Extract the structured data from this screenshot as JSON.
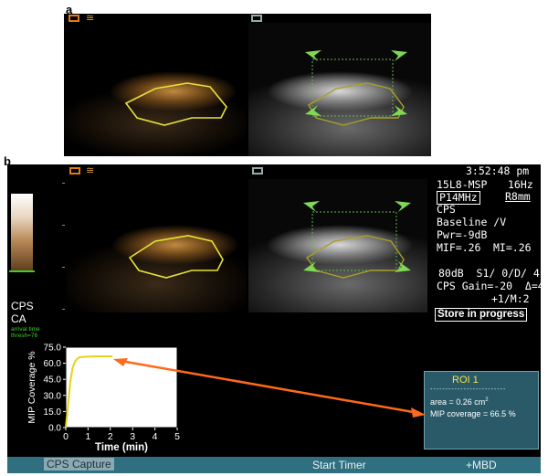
{
  "panel_a": {
    "label": "a"
  },
  "panel_b": {
    "label": "b"
  },
  "scanner": {
    "time": "3:52:48 pm",
    "probe": "15L8-MSP",
    "frame_rate": "16Hz",
    "freq": "P14MHz",
    "depth": "R8mm",
    "mode": "CPS",
    "baseline": "Baseline /V",
    "pwr": "Pwr=-9dB",
    "mif": "MIF=.26",
    "mi": "MI=.26",
    "dr": "80dB  S1/ 0/D/ 4",
    "cps_gain": "CPS Gain=-20  Δ=4",
    "persist": "+1/M:2",
    "store": "Store in progress"
  },
  "colorbar": {
    "label1": "CPS",
    "label2": "CA",
    "arrival_line1": "arrival time",
    "arrival_line2": "thresh=76"
  },
  "roi": {
    "title": "ROI 1",
    "divider": "-------------------------",
    "area_label": "area = 0.26 cm",
    "area_sup": "2",
    "mip": "MIP coverage = 66.5 %"
  },
  "statusbar": {
    "left": "CPS Capture",
    "center": "Start Timer",
    "right": "+MBD"
  },
  "colors": {
    "roi_outline": "#e5e23a",
    "arrow_green": "#7ed957",
    "annotation_orange": "#ff6a1a",
    "status_bar": "#2f6f80"
  },
  "chart_data": {
    "type": "line",
    "ylabel": "MIP Coverage %",
    "xlabel": "Time (min)",
    "xlim": [
      0,
      5
    ],
    "ylim": [
      0,
      75
    ],
    "xticks": [
      "0",
      "1",
      "2",
      "3",
      "4",
      "5"
    ],
    "yticks": [
      "0.0",
      "15.0",
      "30.0",
      "45.0",
      "60.0",
      "75.0"
    ],
    "series": [
      {
        "x": [
          0,
          0.1,
          0.2,
          0.3,
          0.4,
          0.5,
          0.6,
          0.8,
          1.0,
          1.5,
          2.0,
          2.1
        ],
        "y": [
          0,
          20,
          42,
          55,
          61,
          64,
          65.5,
          66,
          66.3,
          66.5,
          66.5,
          66.5
        ]
      }
    ]
  }
}
